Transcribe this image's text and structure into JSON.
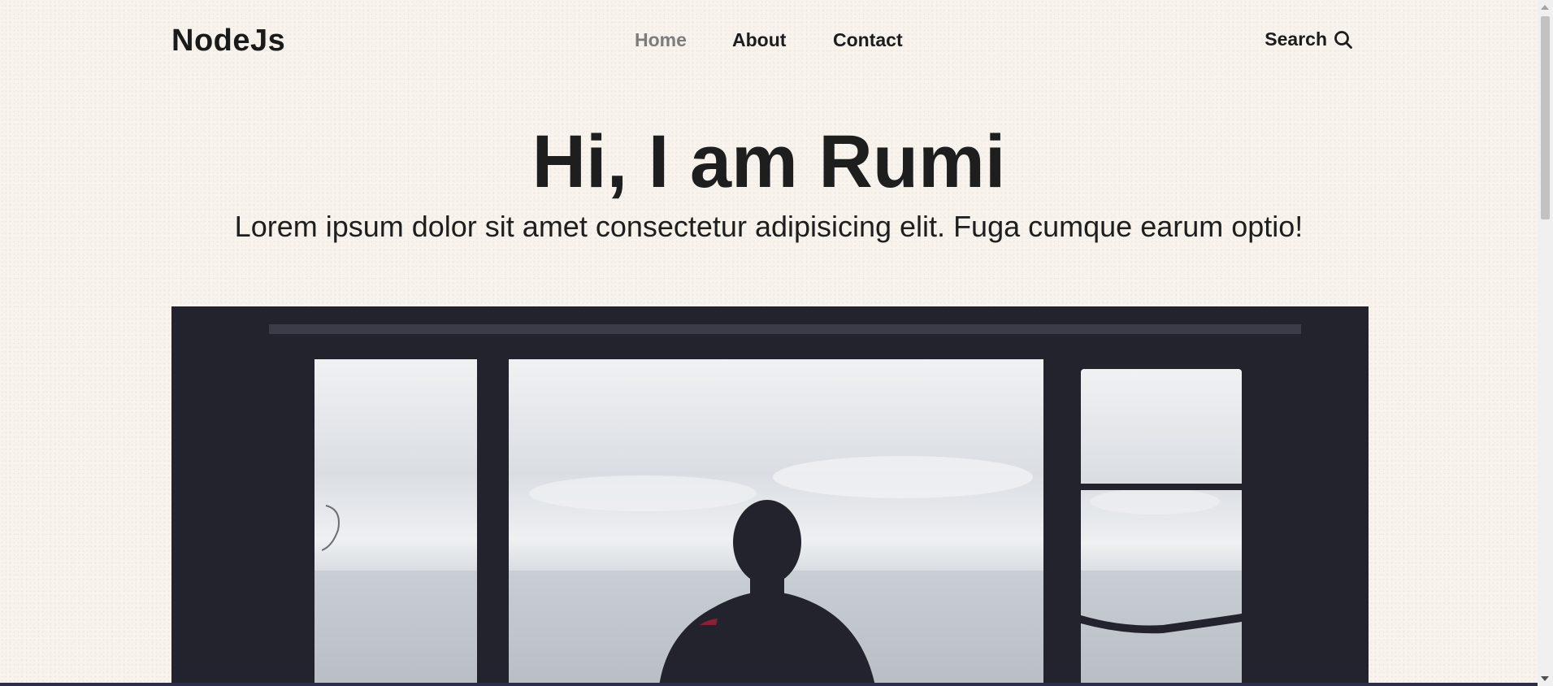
{
  "header": {
    "logo": "NodeJs",
    "nav": [
      {
        "label": "Home",
        "active": true
      },
      {
        "label": "About",
        "active": false
      },
      {
        "label": "Contact",
        "active": false
      }
    ],
    "search_label": "Search",
    "search_icon": "search-icon"
  },
  "hero": {
    "title": "Hi, I am Rumi",
    "subtitle": "Lorem ipsum dolor sit amet consectetur adipisicing elit. Fuga cumque earum optio!"
  },
  "colors": {
    "background": "#f8f3ed",
    "text": "#1c1c1c",
    "nav_active": "#7c7c7c",
    "image_frame": "#22232d"
  }
}
